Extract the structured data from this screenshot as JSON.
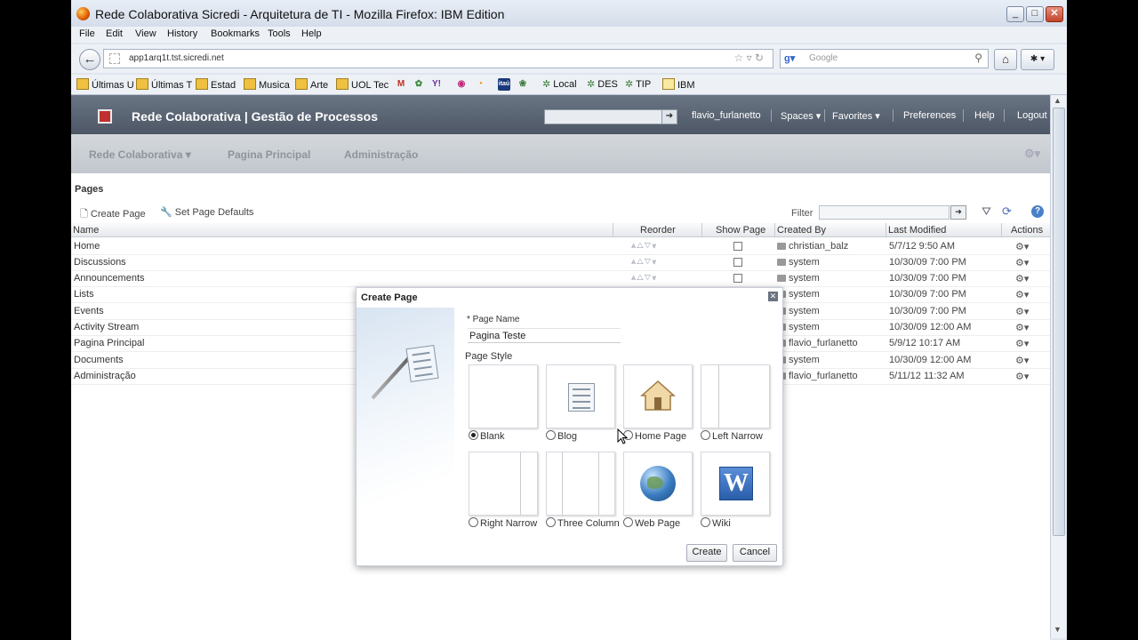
{
  "browser": {
    "title": "Rede Colaborativa Sicredi - Arquitetura de TI - Mozilla Firefox: IBM Edition",
    "menu": [
      "File",
      "Edit",
      "View",
      "History",
      "Bookmarks",
      "Tools",
      "Help"
    ],
    "url": "app1arq1t.tst.sicredi.net",
    "search_placeholder": "Google",
    "bookmarks": [
      "Últimas U",
      "Últimas T",
      "Estad",
      "Musica",
      "Arte",
      "UOL Tec",
      "Local",
      "DES",
      "TIP",
      "IBM"
    ]
  },
  "app": {
    "title": "Rede Colaborativa | Gestão de Processos",
    "user": "flavio_furlanetto",
    "links": [
      "Spaces ▾",
      "Favorites ▾",
      "Preferences",
      "Help",
      "Logout"
    ],
    "subnav": [
      "Rede Colaborativa ▾",
      "Pagina Principal",
      "Administração"
    ]
  },
  "pages": {
    "heading": "Pages",
    "create_page": "Create Page",
    "set_defaults": "Set Page Defaults",
    "filter_label": "Filter",
    "columns": [
      "Name",
      "Reorder",
      "Show Page",
      "Created By",
      "Last Modified",
      "Actions"
    ],
    "rows": [
      {
        "name": "Home",
        "created_by": "christian_balz",
        "modified": "5/7/12 9:50 AM"
      },
      {
        "name": "Discussions",
        "created_by": "system",
        "modified": "10/30/09 7:00 PM"
      },
      {
        "name": "Announcements",
        "created_by": "system",
        "modified": "10/30/09 7:00 PM"
      },
      {
        "name": "Lists",
        "created_by": "system",
        "modified": "10/30/09 7:00 PM"
      },
      {
        "name": "Events",
        "created_by": "system",
        "modified": "10/30/09 7:00 PM"
      },
      {
        "name": "Activity Stream",
        "created_by": "system",
        "modified": "10/30/09 12:00 AM"
      },
      {
        "name": "Pagina Principal",
        "created_by": "flavio_furlanetto",
        "modified": "5/9/12 10:17 AM"
      },
      {
        "name": "Documents",
        "created_by": "system",
        "modified": "10/30/09 12:00 AM"
      },
      {
        "name": "Administração",
        "created_by": "flavio_furlanetto",
        "modified": "5/11/12 11:32 AM"
      }
    ]
  },
  "dialog": {
    "title": "Create Page",
    "page_name_label": "* Page Name",
    "page_name_value": "Pagina Teste",
    "page_style_label": "Page Style",
    "styles": [
      "Blank",
      "Blog",
      "Home Page",
      "Left Narrow",
      "Right Narrow",
      "Three Column",
      "Web Page",
      "Wiki"
    ],
    "selected_style": "Blank",
    "create_label": "Create",
    "cancel_label": "Cancel"
  }
}
